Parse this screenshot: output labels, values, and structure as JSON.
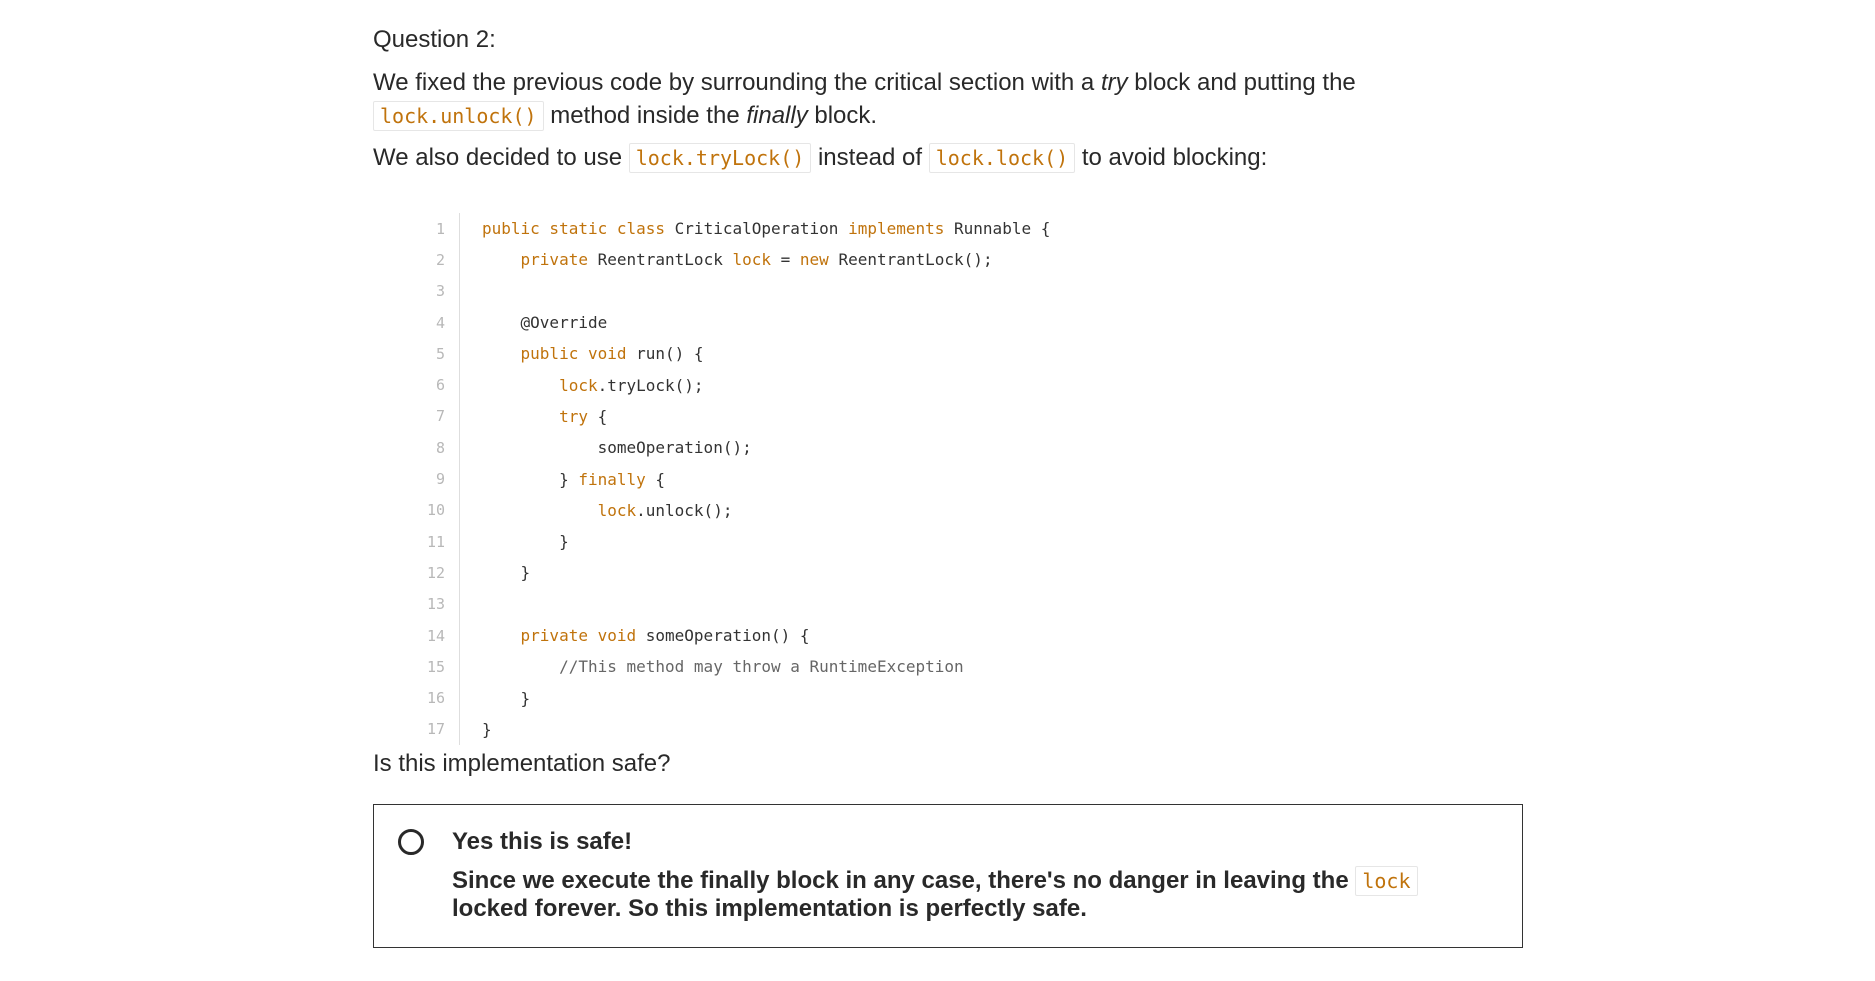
{
  "question": {
    "title": "Question 2:",
    "para1": {
      "part1": "We fixed the previous code by surrounding the critical section with a ",
      "em1": "try",
      "part2": " block and putting the ",
      "code1": "lock.unlock()",
      "part3": " method inside the ",
      "em2": "finally",
      "part4": " block."
    },
    "para2": {
      "part1": "We also decided to use ",
      "code1": "lock.tryLock()",
      "part2": " instead of ",
      "code2": "lock.lock()",
      "part3": " to avoid blocking:"
    },
    "prompt": "Is this implementation safe?"
  },
  "code": {
    "lines": [
      {
        "n": "1",
        "tokens": [
          {
            "t": "public static class",
            "k": "kw"
          },
          {
            "t": " CriticalOperation ",
            "k": ""
          },
          {
            "t": "implements",
            "k": "kw"
          },
          {
            "t": " Runnable {",
            "k": ""
          }
        ]
      },
      {
        "n": "2",
        "tokens": [
          {
            "t": "    ",
            "k": ""
          },
          {
            "t": "private",
            "k": "kw"
          },
          {
            "t": " ReentrantLock ",
            "k": ""
          },
          {
            "t": "lock",
            "k": "kw"
          },
          {
            "t": " = ",
            "k": ""
          },
          {
            "t": "new",
            "k": "kw"
          },
          {
            "t": " ReentrantLock();",
            "k": ""
          }
        ]
      },
      {
        "n": "3",
        "tokens": []
      },
      {
        "n": "4",
        "tokens": [
          {
            "t": "    @Override",
            "k": ""
          }
        ]
      },
      {
        "n": "5",
        "tokens": [
          {
            "t": "    ",
            "k": ""
          },
          {
            "t": "public void",
            "k": "kw"
          },
          {
            "t": " run() {",
            "k": ""
          }
        ]
      },
      {
        "n": "6",
        "tokens": [
          {
            "t": "        ",
            "k": ""
          },
          {
            "t": "lock",
            "k": "kw"
          },
          {
            "t": ".tryLock();",
            "k": ""
          }
        ]
      },
      {
        "n": "7",
        "tokens": [
          {
            "t": "        ",
            "k": ""
          },
          {
            "t": "try",
            "k": "kw"
          },
          {
            "t": " {",
            "k": ""
          }
        ]
      },
      {
        "n": "8",
        "tokens": [
          {
            "t": "            someOperation();",
            "k": ""
          }
        ]
      },
      {
        "n": "9",
        "tokens": [
          {
            "t": "        } ",
            "k": ""
          },
          {
            "t": "finally",
            "k": "kw"
          },
          {
            "t": " {",
            "k": ""
          }
        ]
      },
      {
        "n": "10",
        "tokens": [
          {
            "t": "            ",
            "k": ""
          },
          {
            "t": "lock",
            "k": "kw"
          },
          {
            "t": ".unlock();",
            "k": ""
          }
        ]
      },
      {
        "n": "11",
        "tokens": [
          {
            "t": "        }",
            "k": ""
          }
        ]
      },
      {
        "n": "12",
        "tokens": [
          {
            "t": "    }",
            "k": ""
          }
        ]
      },
      {
        "n": "13",
        "tokens": []
      },
      {
        "n": "14",
        "tokens": [
          {
            "t": "    ",
            "k": ""
          },
          {
            "t": "private void",
            "k": "kw"
          },
          {
            "t": " someOperation() {",
            "k": ""
          }
        ]
      },
      {
        "n": "15",
        "tokens": [
          {
            "t": "        ",
            "k": ""
          },
          {
            "t": "//This method may throw a RuntimeException",
            "k": "cm"
          }
        ]
      },
      {
        "n": "16",
        "tokens": [
          {
            "t": "    }",
            "k": ""
          }
        ]
      },
      {
        "n": "17",
        "tokens": [
          {
            "t": "}",
            "k": ""
          }
        ]
      }
    ]
  },
  "option": {
    "title": "Yes this is safe!",
    "desc_part1": "Since we execute the finally block in any case, there's no danger in leaving the ",
    "desc_code": "lock",
    "desc_part2": " locked forever. So this implementation is perfectly safe."
  },
  "colors": {
    "keyword": "#c0730c",
    "text": "#292929",
    "border": "#333333"
  }
}
